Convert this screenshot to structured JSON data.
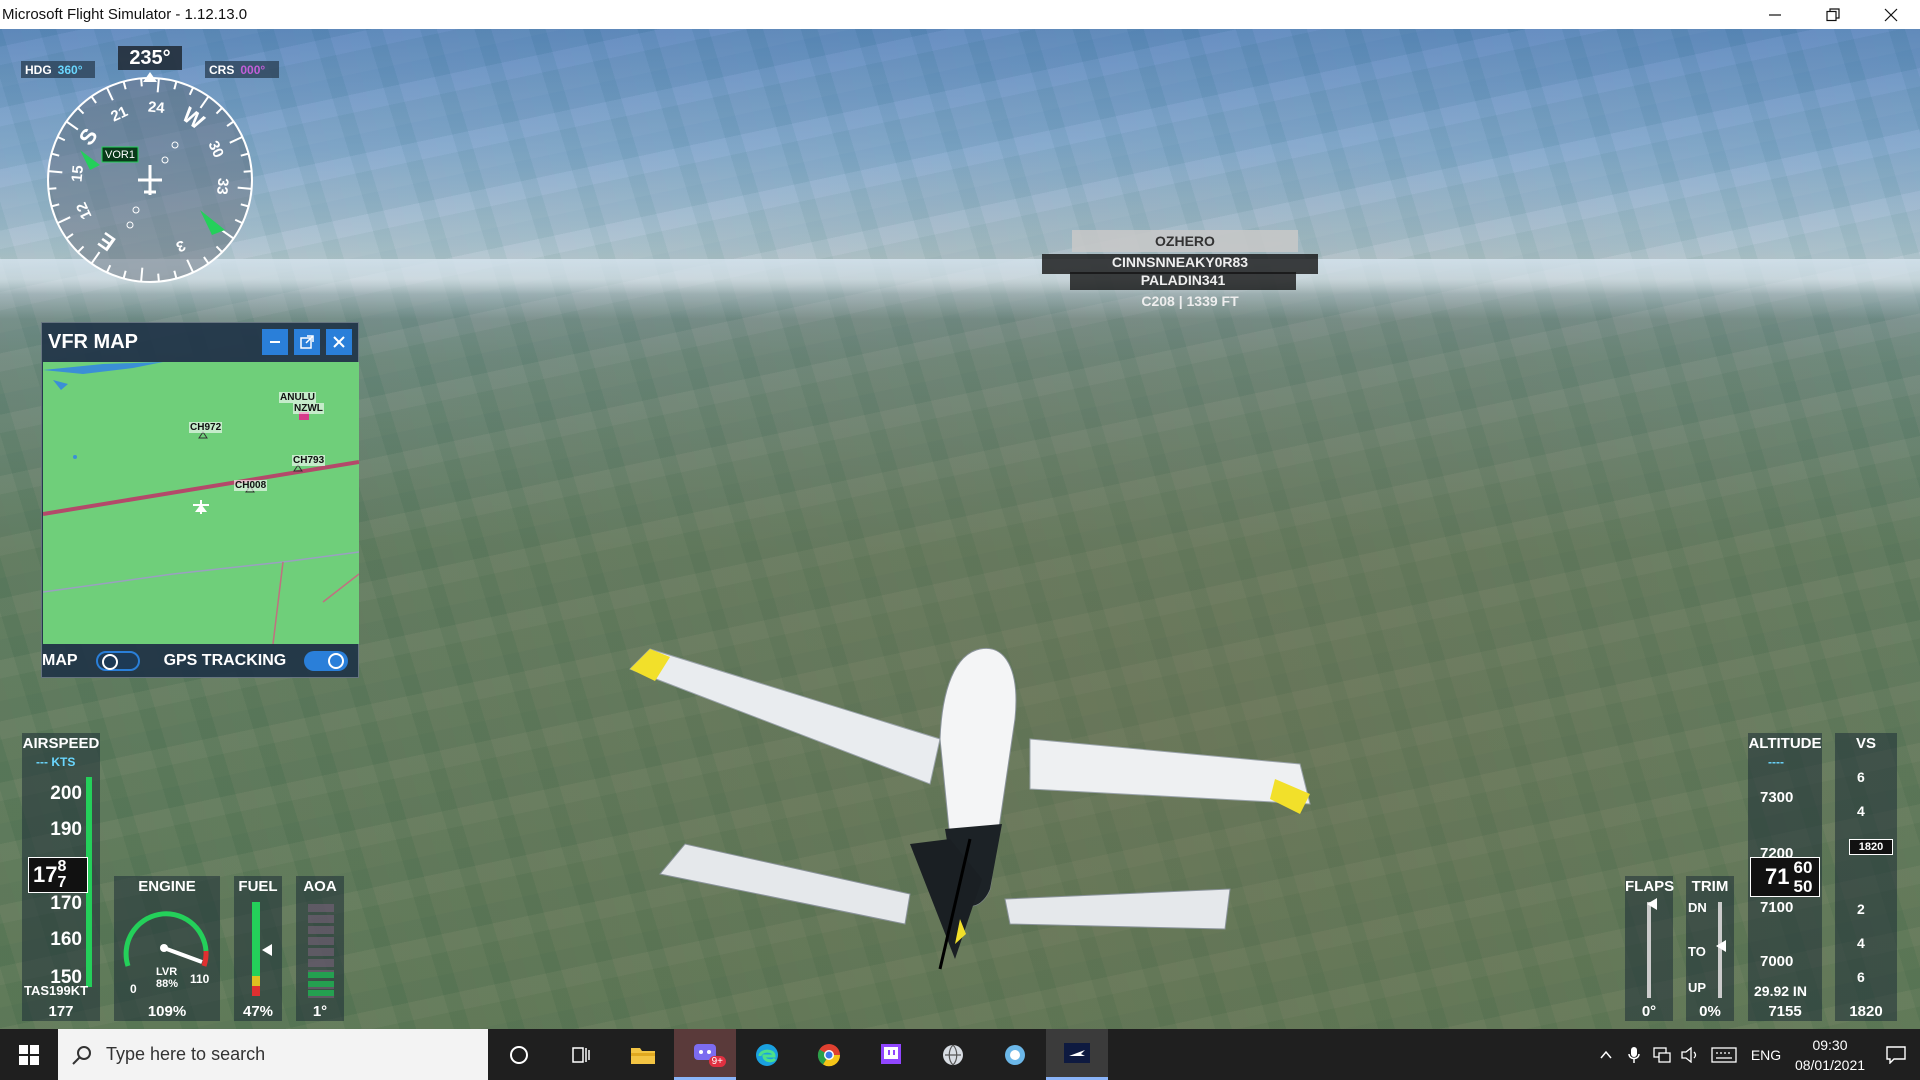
{
  "window": {
    "title": "Microsoft Flight Simulator - 1.12.13.0"
  },
  "compass": {
    "hdg_label": "HDG",
    "hdg_value": "360°",
    "crs_label": "CRS",
    "crs_value": "000°",
    "heading": "235°",
    "nav_label": "VOR1",
    "cardinals": [
      "21",
      "24",
      "W",
      "30",
      "33",
      "3",
      "E",
      "12",
      "15",
      "S"
    ],
    "accent_hdg": "#6ad7ff",
    "accent_crs": "#c35fd9"
  },
  "vfr_map": {
    "title": "VFR MAP",
    "waypoints": [
      "ANULU",
      "NZWL",
      "CH972",
      "CH793",
      "CH008"
    ],
    "footer_map_label": "MAP",
    "footer_gps_label": "GPS TRACKING"
  },
  "multiplayer": {
    "tag_top": "OZHERO",
    "tag_line1": "CINNSNNEAKY0R83",
    "tag_line2": "PALADIN341",
    "tag_line3": "C208 | 1339 FT"
  },
  "airspeed": {
    "title": "AIRSPEED",
    "unit": "--- KTS",
    "ticks": [
      "200",
      "190",
      "170",
      "160",
      "150"
    ],
    "current": "177",
    "current_main": "17",
    "current_digit_top": "8",
    "current_digit_bottom": "7",
    "tas": "TAS199KT",
    "bottom": "177"
  },
  "engine": {
    "title": "ENGINE",
    "gauge_min": "0",
    "gauge_max": "110",
    "lever": "LVR",
    "lever_pct": "88%",
    "bottom": "109%"
  },
  "fuel": {
    "title": "FUEL",
    "bottom": "47%"
  },
  "aoa": {
    "title": "AOA",
    "bottom": "1°"
  },
  "flaps": {
    "title": "FLAPS",
    "bottom": "0°"
  },
  "trim": {
    "title": "TRIM",
    "dn": "DN",
    "to": "TO",
    "up": "UP",
    "bottom": "0%"
  },
  "altitude": {
    "title": "ALTITUDE",
    "selected": "----",
    "ticks": [
      "7300",
      "7200",
      "7100",
      "7000"
    ],
    "current_main": "71",
    "current_top": "60",
    "current_bottom": "50",
    "baro": "29.92 IN",
    "bottom": "7155"
  },
  "vs": {
    "title": "VS",
    "ticks": [
      "6",
      "4",
      "2",
      "4",
      "6"
    ],
    "current": "1820",
    "bottom": "1820"
  },
  "taskbar": {
    "search_placeholder": "Type here to search",
    "badge": "9+",
    "lang": "ENG",
    "time": "09:30",
    "date": "08/01/2021"
  }
}
